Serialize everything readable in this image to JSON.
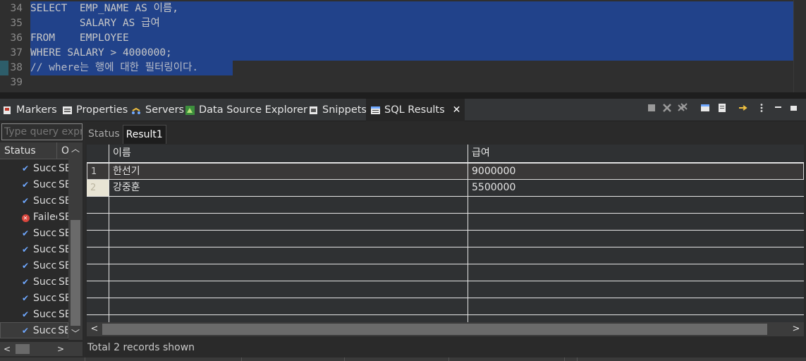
{
  "editor": {
    "lines": [
      {
        "num": "34",
        "text": "SELECT  EMP_NAME AS 이름,"
      },
      {
        "num": "35",
        "text": "        SALARY AS 급여"
      },
      {
        "num": "36",
        "text": "FROM    EMPLOYEE"
      },
      {
        "num": "37",
        "text": "WHERE SALARY > 4000000;"
      },
      {
        "num": "38",
        "text": "// where는 행에 대한 필터링이다."
      },
      {
        "num": "39",
        "text": ""
      }
    ],
    "colors": {
      "selection": "#21428a",
      "background": "#2f2f2f"
    }
  },
  "tabs": [
    {
      "label": "Markers",
      "icon": "markers-icon"
    },
    {
      "label": "Properties",
      "icon": "properties-icon"
    },
    {
      "label": "Servers",
      "icon": "servers-icon"
    },
    {
      "label": "Data Source Explorer",
      "icon": "data-source-explorer-icon"
    },
    {
      "label": "Snippets",
      "icon": "snippets-icon"
    },
    {
      "label": "SQL Results",
      "icon": "sql-results-icon",
      "active": true
    }
  ],
  "toolbar": [
    "stop-icon",
    "remove-icon",
    "remove-all-icon",
    "display-icon",
    "save-icon",
    "arrow-icon",
    "view-menu-icon",
    "minimize-icon",
    "maximize-icon"
  ],
  "history": {
    "filter_placeholder": "Type query expr",
    "columns": [
      "Status",
      "Op"
    ],
    "rows": [
      {
        "status": "Succe",
        "op": "SE",
        "state": "success"
      },
      {
        "status": "Succe",
        "op": "SE",
        "state": "success"
      },
      {
        "status": "Succe",
        "op": "SE",
        "state": "success"
      },
      {
        "status": "Failec",
        "op": "SE",
        "state": "failed"
      },
      {
        "status": "Succe",
        "op": "SE",
        "state": "success"
      },
      {
        "status": "Succe",
        "op": "SE",
        "state": "success"
      },
      {
        "status": "Succe",
        "op": "SE",
        "state": "success"
      },
      {
        "status": "Succe",
        "op": "SE",
        "state": "success"
      },
      {
        "status": "Succe",
        "op": "SE",
        "state": "success"
      },
      {
        "status": "Succe",
        "op": "SE",
        "state": "success"
      },
      {
        "status": "Succe",
        "op": "SE",
        "state": "success",
        "selected": true
      }
    ]
  },
  "results": {
    "subtabs": [
      {
        "label": "Status",
        "active": false
      },
      {
        "label": "Result1",
        "active": true
      }
    ],
    "columns": [
      "이름",
      "급여"
    ],
    "rows": [
      {
        "num": "1",
        "cells": [
          "한선기",
          "9000000"
        ]
      },
      {
        "num": "2",
        "cells": [
          "강중훈",
          "5500000"
        ]
      }
    ],
    "status_text": "Total 2 records shown"
  }
}
